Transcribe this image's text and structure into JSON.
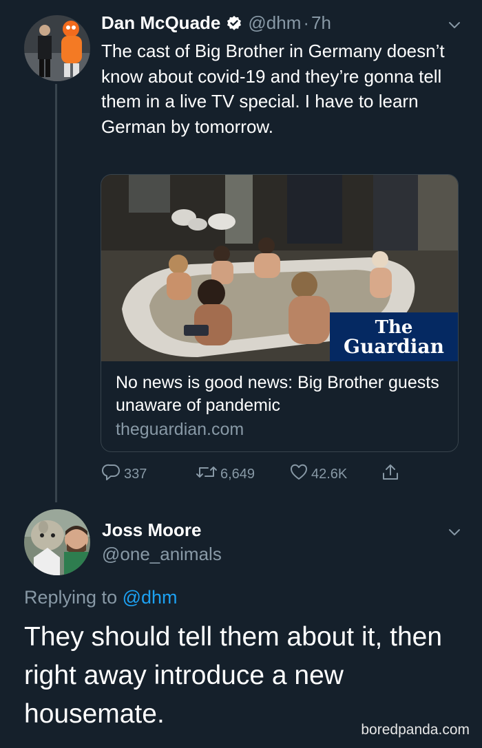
{
  "tweet1": {
    "author_name": "Dan McQuade",
    "handle": "@dhm",
    "separator": "·",
    "time": "7h",
    "text": "The cast of Big Brother in Germany doesn’t know about covid-19 and they’re gonna tell them in a live TV special. I have to learn German by tomorrow.",
    "card": {
      "brand_line1": "The",
      "brand_line2": "Guardian",
      "title": "No news is good news: Big Brother guests unaware of pandemic",
      "domain": "theguardian.com"
    },
    "actions": {
      "replies": "337",
      "retweets": "6,649",
      "likes": "42.6K"
    }
  },
  "tweet2": {
    "author_name": "Joss Moore",
    "handle": "@one_animals",
    "replying_prefix": "Replying to",
    "replying_to": "@dhm",
    "text": "They should tell them about it, then right away introduce a new housemate."
  },
  "watermark": "boredpanda.com",
  "colors": {
    "background": "#15202b",
    "muted": "#8899a6",
    "link": "#1da1f2",
    "guardian": "#052962",
    "divider": "#38444d"
  },
  "icons": [
    "verified-icon",
    "chevron-down-icon",
    "reply-icon",
    "retweet-icon",
    "like-icon",
    "share-icon"
  ]
}
